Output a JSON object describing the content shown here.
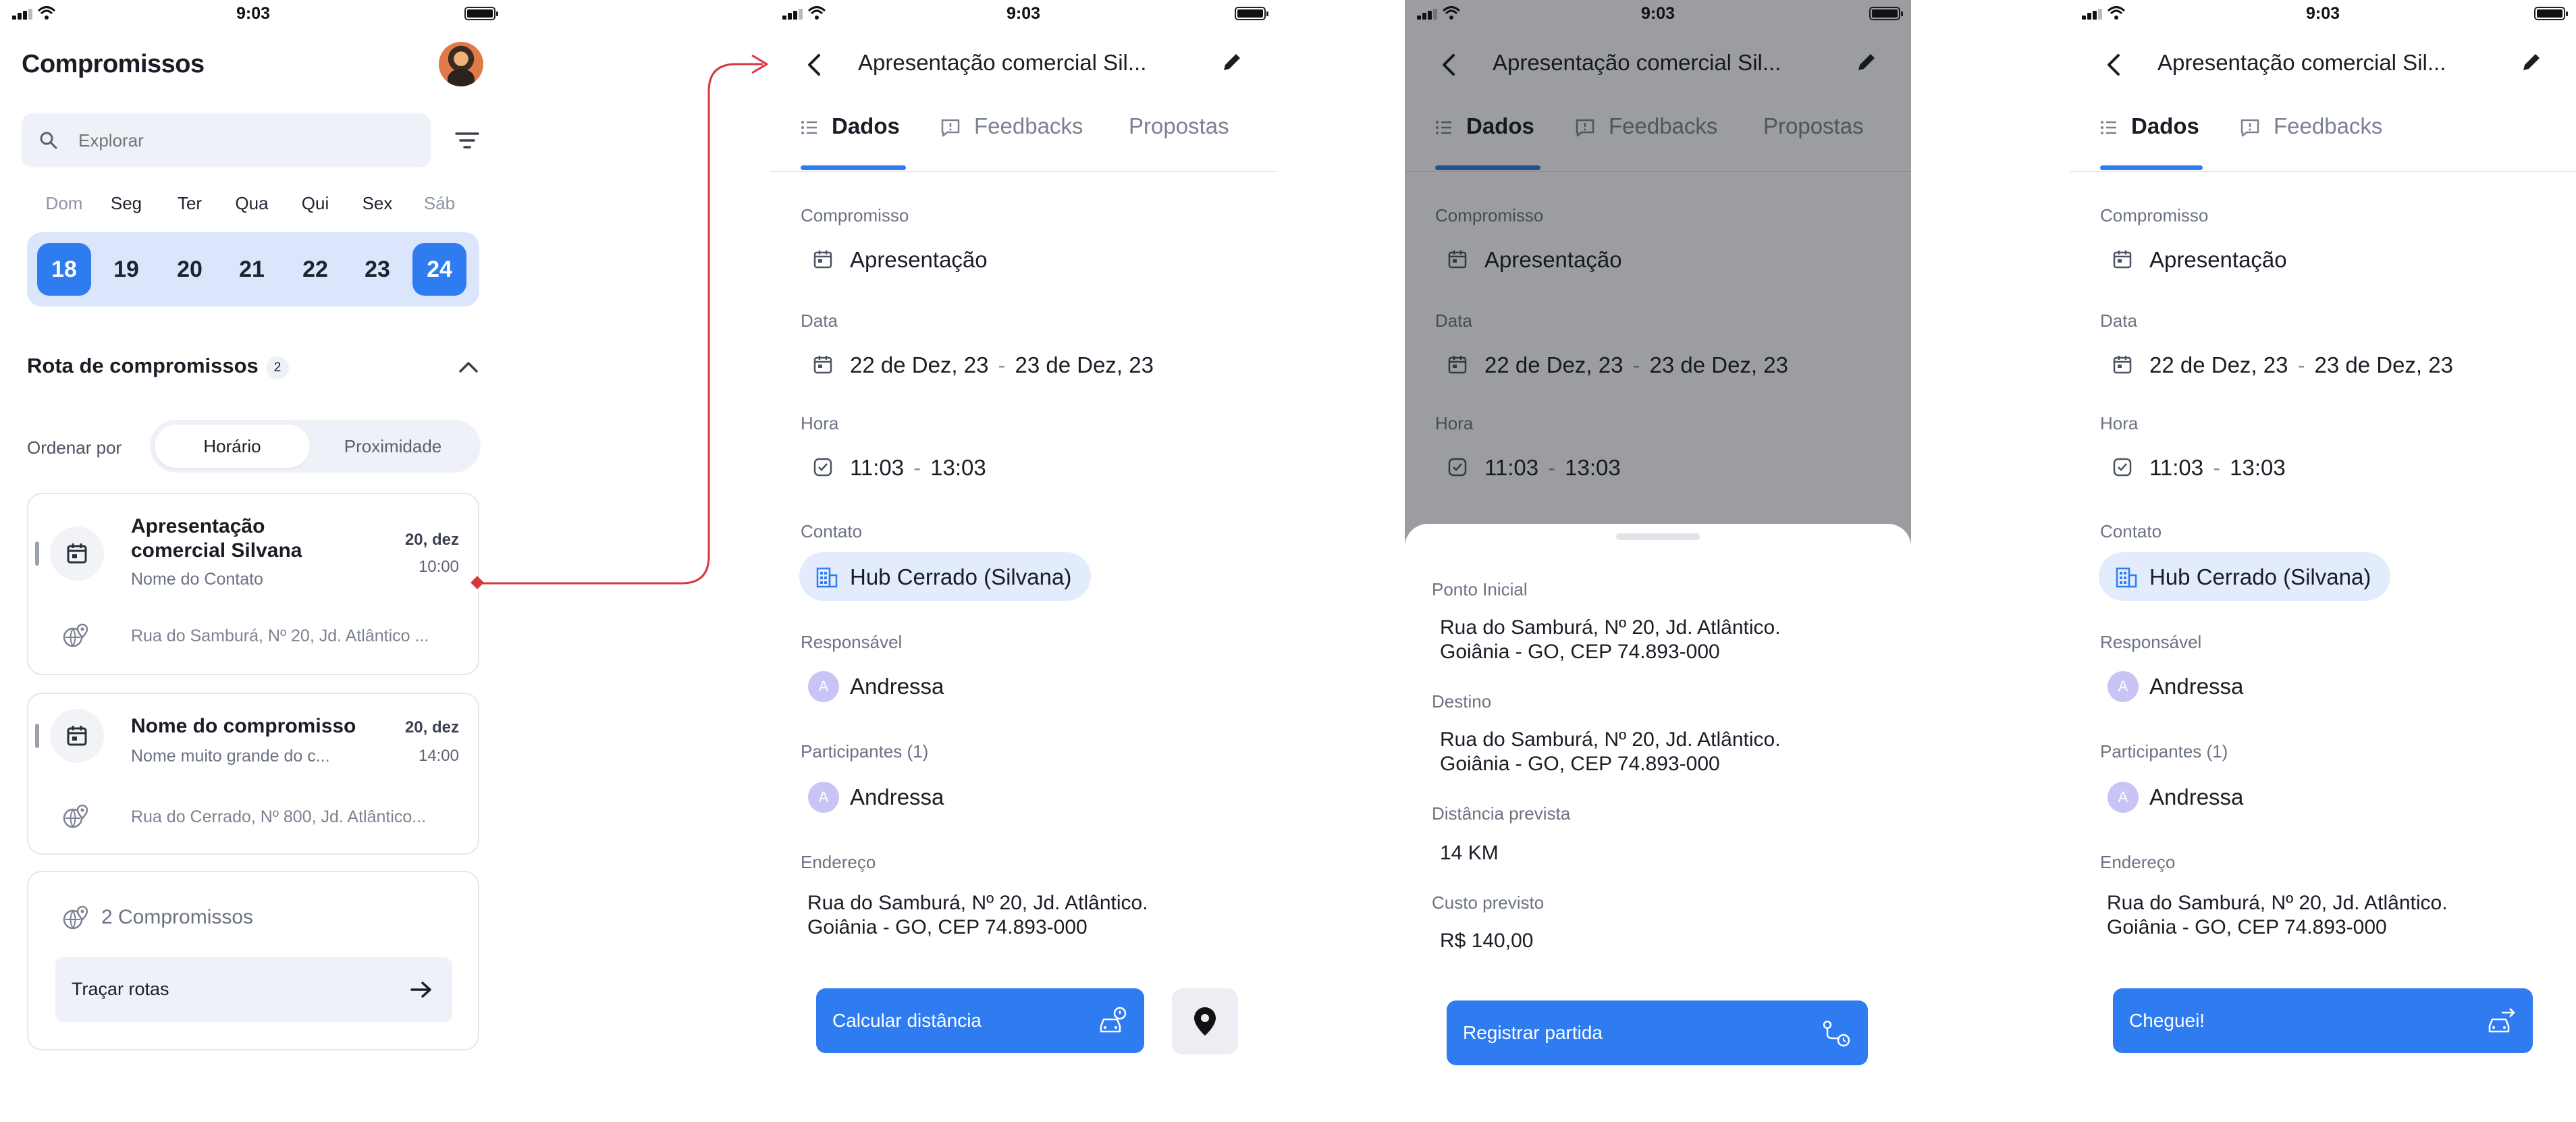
{
  "status": {
    "time": "9:03"
  },
  "home": {
    "title": "Compromissos",
    "search_placeholder": "Explorar",
    "weekdays": [
      "Dom",
      "Seg",
      "Ter",
      "Qua",
      "Qui",
      "Sex",
      "Sáb"
    ],
    "dates": [
      "18",
      "19",
      "20",
      "21",
      "22",
      "23",
      "24"
    ],
    "selected_dates": [
      "18",
      "24"
    ],
    "rota_title": "Rota de compromissos",
    "rota_count": "2",
    "ordenar_label": "Ordenar por",
    "sort_options": [
      "Horário",
      "Proximidade"
    ],
    "sort_selected": "Horário",
    "appointments": [
      {
        "title_line1": "Apresentação",
        "title_line2": "comercial Silvana",
        "subtitle": "Nome do Contato",
        "date": "20, dez",
        "time": "10:00",
        "address": "Rua do Samburá, Nº 20, Jd. Atlântico ..."
      },
      {
        "title_line1": "Nome do compromisso",
        "subtitle": "Nome muito grande do c...",
        "date": "20, dez",
        "time": "14:00",
        "address": "Rua do Cerrado, Nº 800, Jd. Atlântico..."
      }
    ],
    "summary_count": "2 Compromissos",
    "route_button": "Traçar rotas"
  },
  "detail": {
    "title": "Apresentação comercial Sil...",
    "tabs": [
      "Dados",
      "Feedbacks",
      "Propostas"
    ],
    "active_tab": "Dados",
    "compromisso_label": "Compromisso",
    "compromisso_value": "Apresentação",
    "data_label": "Data",
    "data_start": "22 de Dez, 23",
    "data_sep": "-",
    "data_end": "23 de Dez, 23",
    "hora_label": "Hora",
    "hora_start": "11:03",
    "hora_sep": "-",
    "hora_end": "13:03",
    "contato_label": "Contato",
    "contato_value": "Hub Cerrado (Silvana)",
    "responsavel_label": "Responsável",
    "responsavel_value": "Andressa",
    "avatar_initial": "A",
    "participantes_label": "Participantes (1)",
    "participante_value": "Andressa",
    "endereco_label": "Endereço",
    "endereco_line1": "Rua do Samburá, Nº 20, Jd. Atlântico.",
    "endereco_line2": "Goiânia - GO, CEP 74.893-000",
    "calc_button": "Calcular distância",
    "registrar_button": "Registrar partida",
    "chegou_button": "Cheguei!"
  },
  "sheet": {
    "ponto_label": "Ponto Inicial",
    "ponto_line1": "Rua do Samburá, Nº 20, Jd. Atlântico.",
    "ponto_line2": "Goiânia - GO, CEP 74.893-000",
    "destino_label": "Destino",
    "destino_line1": "Rua do Samburá, Nº 20, Jd. Atlântico.",
    "destino_line2": "Goiânia - GO, CEP 74.893-000",
    "distancia_label": "Distância prevista",
    "distancia_value": "14 KM",
    "custo_label": "Custo previsto",
    "custo_value": "R$ 140,00"
  },
  "colors": {
    "accent": "#2f7bf0",
    "connector": "#d9363e",
    "strip": "#dbe5fb"
  }
}
